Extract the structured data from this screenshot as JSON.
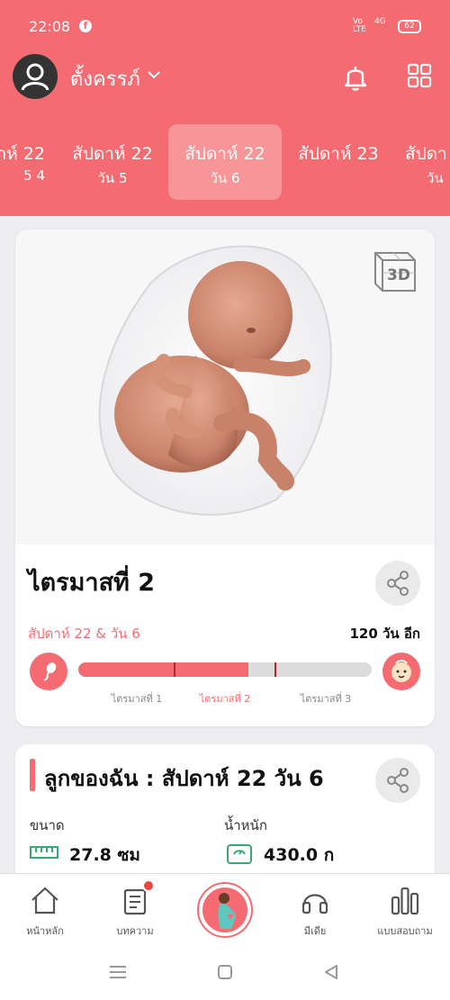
{
  "status": {
    "time": "22:08",
    "signal": "Vo LTE",
    "net": "4G",
    "battery": "62"
  },
  "app": {
    "title": "ตั้งครรภ์"
  },
  "weeks": [
    {
      "label": "าห์ 22",
      "sub": "5 4",
      "active": false
    },
    {
      "label": "สัปดาห์ 22",
      "sub": "วัน 5",
      "active": false
    },
    {
      "label": "สัปดาห์ 22",
      "sub": "วัน 6",
      "active": true
    },
    {
      "label": "สัปดาห์ 23",
      "sub": "",
      "active": false
    },
    {
      "label": "สัปดา",
      "sub": "วัน",
      "active": false
    }
  ],
  "trimester": {
    "title": "ไตรมาสที่ 2",
    "week_day": "สัปดาห์ 22 & วัน 6",
    "days_left": "120 วัน อีก",
    "progress": 0.58,
    "labels": [
      "ไตรมาสที่ 1",
      "ไตรมาสที่ 2",
      "ไตรมาสที่ 3"
    ],
    "badge": "3D"
  },
  "baby": {
    "title": "ลูกของฉัน : สัปดาห์ 22 วัน 6",
    "size_label": "ขนาด",
    "size_value": "27.8 ซม",
    "weight_label": "น้ำหนัก",
    "weight_value": "430.0 ก"
  },
  "nav": [
    {
      "label": "หน้าหลัก",
      "icon": "home-icon"
    },
    {
      "label": "บทความ",
      "icon": "article-icon"
    },
    {
      "label": "",
      "icon": "pregnant-icon"
    },
    {
      "label": "มีเดีย",
      "icon": "headphones-icon"
    },
    {
      "label": "แบบสอบถาม",
      "icon": "poll-icon"
    }
  ],
  "colors": {
    "accent": "#f46c72",
    "background": "#eeeef2",
    "tick": "#b7262c"
  }
}
